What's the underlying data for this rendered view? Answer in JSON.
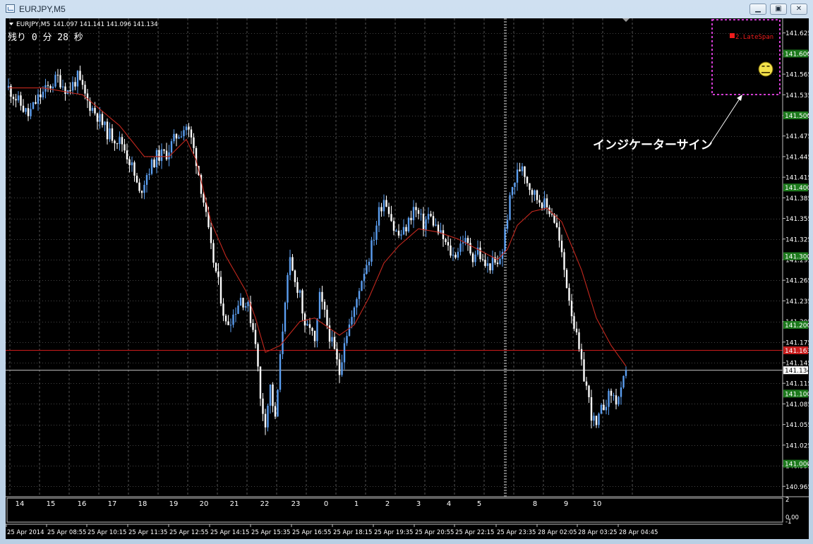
{
  "window": {
    "title": "EURJPY,M5",
    "controls": {
      "minimize": "▁",
      "restore": "▣",
      "close": "✕"
    }
  },
  "chart_header": {
    "symbol": "EURJPY,M5",
    "ohlc": "141.097 141.141 141.096 141.134",
    "timer_text": "残り 0 分 28 秒"
  },
  "indicator_box": {
    "label": "2.LateSpan",
    "face_icon": "neutral-face-icon",
    "callout_text": "インジケーターサイン"
  },
  "price_axis": {
    "labels": [
      "141.625",
      "141.595",
      "141.565",
      "141.535",
      "141.505",
      "141.475",
      "141.445",
      "141.415",
      "141.385",
      "141.355",
      "141.325",
      "141.295",
      "141.265",
      "141.235",
      "141.205",
      "141.175",
      "141.145",
      "141.115",
      "141.085",
      "141.055",
      "141.025",
      "140.995",
      "140.965"
    ],
    "highlighted": [
      {
        "price": 141.595,
        "text": "141.600",
        "kind": "level"
      },
      {
        "price": 141.505,
        "text": "141.500",
        "kind": "level"
      },
      {
        "price": 141.4,
        "text": "141.400",
        "kind": "level"
      },
      {
        "price": 141.3,
        "text": "141.300",
        "kind": "level"
      },
      {
        "price": 141.2,
        "text": "141.200",
        "kind": "level"
      },
      {
        "price": 141.163,
        "text": "141.163",
        "kind": "alert"
      },
      {
        "price": 141.134,
        "text": "141.134",
        "kind": "bid"
      },
      {
        "price": 141.1,
        "text": "141.100",
        "kind": "level"
      },
      {
        "price": 140.998,
        "text": "141.000",
        "kind": "level"
      }
    ]
  },
  "sub_window": {
    "hour_labels": [
      "14",
      "15",
      "16",
      "17",
      "18",
      "19",
      "20",
      "21",
      "22",
      "23",
      "0",
      "1",
      "2",
      "3",
      "4",
      "5",
      "8",
      "9",
      "10"
    ],
    "axis_labels": [
      "2",
      "0.00",
      "-1"
    ]
  },
  "time_axis": {
    "labels": [
      "25 Apr 2014",
      "25 Apr 08:55",
      "25 Apr 10:15",
      "25 Apr 11:35",
      "25 Apr 12:55",
      "25 Apr 14:15",
      "25 Apr 15:35",
      "25 Apr 16:55",
      "25 Apr 18:15",
      "25 Apr 19:35",
      "25 Apr 20:55",
      "25 Apr 22:15",
      "25 Apr 23:35",
      "28 Apr 02:05",
      "28 Apr 03:25",
      "28 Apr 04:45"
    ]
  },
  "colors": {
    "background": "#000000",
    "bull": "#5b9ef0",
    "bear": "#ffffff",
    "ma": "#c3281e",
    "alert_line": "#cc1b1b",
    "level_label": "#1d7a1d",
    "grid": "#8a8a8a",
    "indicator_box": "#d23cd2",
    "face": "#f3e24b"
  },
  "chart_data": {
    "type": "candlestick",
    "symbol": "EURJPY",
    "timeframe": "M5",
    "ylim": [
      140.955,
      141.637
    ],
    "alert_level": 141.163,
    "bid": 141.134,
    "waypoints": [
      [
        0,
        141.545
      ],
      [
        4,
        141.525
      ],
      [
        8,
        141.505
      ],
      [
        12,
        141.53
      ],
      [
        16,
        141.545
      ],
      [
        20,
        141.56
      ],
      [
        24,
        141.54
      ],
      [
        28,
        141.56
      ],
      [
        32,
        141.525
      ],
      [
        36,
        141.505
      ],
      [
        40,
        141.48
      ],
      [
        46,
        141.465
      ],
      [
        50,
        141.43
      ],
      [
        53,
        141.39
      ],
      [
        56,
        141.42
      ],
      [
        60,
        141.445
      ],
      [
        64,
        141.45
      ],
      [
        68,
        141.475
      ],
      [
        72,
        141.49
      ],
      [
        74,
        141.47
      ],
      [
        76,
        141.44
      ],
      [
        79,
        141.38
      ],
      [
        82,
        141.31
      ],
      [
        85,
        141.26
      ],
      [
        88,
        141.2
      ],
      [
        91,
        141.215
      ],
      [
        94,
        141.24
      ],
      [
        97,
        141.225
      ],
      [
        100,
        141.18
      ],
      [
        102,
        141.09
      ],
      [
        104,
        141.06
      ],
      [
        106,
        141.11
      ],
      [
        108,
        141.06
      ],
      [
        110,
        141.15
      ],
      [
        112,
        141.24
      ],
      [
        114,
        141.29
      ],
      [
        116,
        141.26
      ],
      [
        118,
        141.25
      ],
      [
        120,
        141.19
      ],
      [
        122,
        141.2
      ],
      [
        124,
        141.17
      ],
      [
        126,
        141.24
      ],
      [
        128,
        141.215
      ],
      [
        130,
        141.185
      ],
      [
        132,
        141.16
      ],
      [
        134,
        141.13
      ],
      [
        136,
        141.18
      ],
      [
        138,
        141.2
      ],
      [
        140,
        141.22
      ],
      [
        142,
        141.255
      ],
      [
        144,
        141.28
      ],
      [
        146,
        141.3
      ],
      [
        148,
        141.33
      ],
      [
        150,
        141.365
      ],
      [
        152,
        141.385
      ],
      [
        154,
        141.37
      ],
      [
        156,
        141.34
      ],
      [
        158,
        141.33
      ],
      [
        160,
        141.335
      ],
      [
        162,
        141.35
      ],
      [
        164,
        141.37
      ],
      [
        166,
        141.36
      ],
      [
        168,
        141.345
      ],
      [
        170,
        141.36
      ],
      [
        172,
        141.35
      ],
      [
        174,
        141.335
      ],
      [
        176,
        141.325
      ],
      [
        178,
        141.31
      ],
      [
        180,
        141.3
      ],
      [
        182,
        141.31
      ],
      [
        184,
        141.325
      ],
      [
        186,
        141.315
      ],
      [
        188,
        141.3
      ],
      [
        190,
        141.31
      ],
      [
        192,
        141.29
      ],
      [
        194,
        141.285
      ],
      [
        196,
        141.29
      ],
      [
        198,
        141.285
      ],
      [
        200,
        141.31
      ],
      [
        202,
        141.36
      ],
      [
        204,
        141.4
      ],
      [
        206,
        141.42
      ],
      [
        208,
        141.435
      ],
      [
        210,
        141.41
      ],
      [
        212,
        141.395
      ],
      [
        214,
        141.385
      ],
      [
        216,
        141.38
      ],
      [
        218,
        141.37
      ],
      [
        220,
        141.365
      ],
      [
        222,
        141.34
      ],
      [
        224,
        141.3
      ],
      [
        226,
        141.26
      ],
      [
        228,
        141.22
      ],
      [
        230,
        141.18
      ],
      [
        232,
        141.14
      ],
      [
        234,
        141.11
      ],
      [
        236,
        141.07
      ],
      [
        238,
        141.05
      ],
      [
        240,
        141.075
      ],
      [
        242,
        141.09
      ],
      [
        244,
        141.1
      ],
      [
        246,
        141.09
      ],
      [
        248,
        141.1
      ],
      [
        250,
        141.134
      ]
    ],
    "ma_points": [
      [
        0,
        141.545
      ],
      [
        14,
        141.545
      ],
      [
        30,
        141.535
      ],
      [
        45,
        141.49
      ],
      [
        55,
        141.445
      ],
      [
        65,
        141.445
      ],
      [
        72,
        141.47
      ],
      [
        76,
        141.44
      ],
      [
        82,
        141.35
      ],
      [
        88,
        141.3
      ],
      [
        96,
        141.25
      ],
      [
        100,
        141.21
      ],
      [
        104,
        141.16
      ],
      [
        110,
        141.17
      ],
      [
        118,
        141.205
      ],
      [
        124,
        141.21
      ],
      [
        130,
        141.195
      ],
      [
        134,
        141.185
      ],
      [
        140,
        141.2
      ],
      [
        146,
        141.24
      ],
      [
        152,
        141.29
      ],
      [
        158,
        141.315
      ],
      [
        166,
        141.34
      ],
      [
        174,
        141.335
      ],
      [
        182,
        141.325
      ],
      [
        190,
        141.31
      ],
      [
        198,
        141.295
      ],
      [
        202,
        141.31
      ],
      [
        206,
        141.345
      ],
      [
        212,
        141.365
      ],
      [
        218,
        141.37
      ],
      [
        224,
        141.35
      ],
      [
        232,
        141.28
      ],
      [
        238,
        141.21
      ],
      [
        244,
        141.17
      ],
      [
        250,
        141.14
      ]
    ]
  }
}
